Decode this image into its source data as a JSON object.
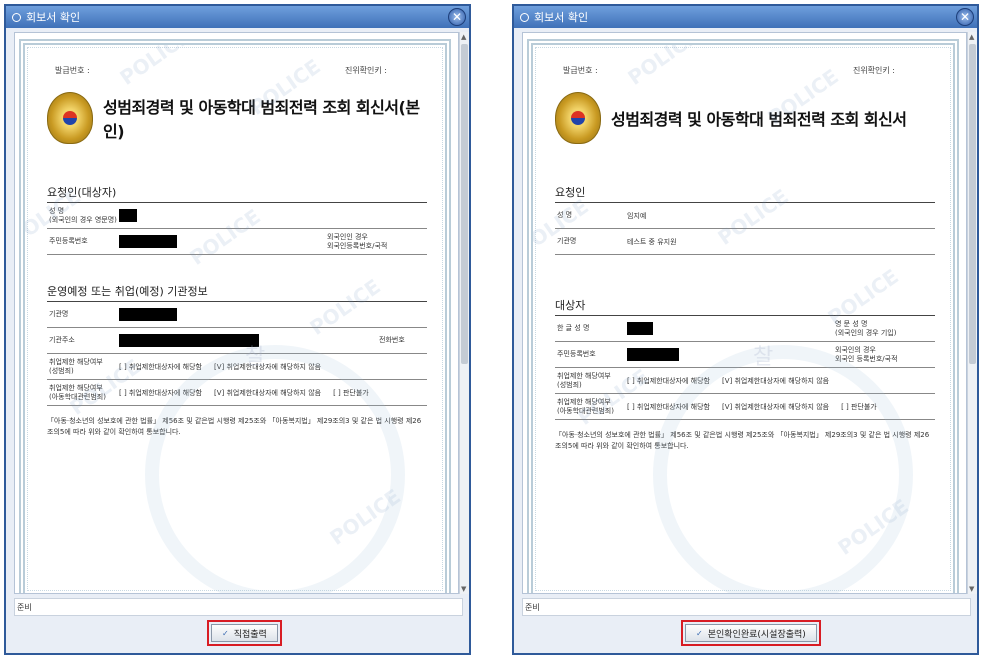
{
  "dialog_title": "회보서 확인",
  "status_label": "준비",
  "left": {
    "issue_no_label": "발급번호 :",
    "verify_key_label": "진위확인키 :",
    "doc_title": "성범죄경력 및 아동학대 범죄전력 조회 회신서(본인)",
    "requester_heading": "요청인(대상자)",
    "name_label": "성 명\n(외국인의 경우 영문명)",
    "rrn_label": "주민등록번호",
    "foreigner_label": "외국인인 경우\n외국인등록번호/국적",
    "institution_heading": "운영예정 또는 취업(예정) 기관정보",
    "inst_name_label": "기관명",
    "inst_addr_label": "기관주소",
    "phone_label": "전화번호",
    "sex_crime_label": "취업제한 해당여부\n(성범죄)",
    "child_abuse_label": "취업제한 해당여부\n(아동학대관련범죄)",
    "opt_applicable": "[ ] 취업제한대상자에 해당함",
    "opt_not_applicable": "[V] 취업제한대상자에 해당하지 않음",
    "opt_undeterminable": "[ ] 판단불가",
    "legal_text": "「아동·청소년의 성보호에 관한 법률」 제56조 및 같은법 시행령 제25조와 「아동복지법」 제29조의3 및 같은 법 시행령 제26조의5에 따라 위와 같이 확인하여 통보합니다.",
    "button_label": "직접출력"
  },
  "right": {
    "issue_no_label": "발급번호 :",
    "verify_key_label": "진위확인키 :",
    "doc_title": "성범죄경력 및 아동학대 범죄전력 조회 회신서",
    "requester_heading": "요청인",
    "name_label": "성 명",
    "name_value": "임지예",
    "inst_name_label": "기관명",
    "inst_name_value": "테스트 중 유지원",
    "subject_heading": "대상자",
    "korean_name_label": "한 글 성 명",
    "english_name_label": "영 문 성 명\n(외국인의 경우 기입)",
    "rrn_label": "주민등록번호",
    "foreigner_label": "외국인의 경우\n외국인 등록번호/국적",
    "sex_crime_label": "취업제한 해당여부\n(성범죄)",
    "child_abuse_label": "취업제한 해당여부\n(아동학대관련범죄)",
    "opt_applicable": "[ ] 취업제한대상자에 해당함",
    "opt_not_applicable": "[V] 취업제한대상자에 해당하지 않음",
    "opt_undeterminable": "[ ] 판단불가",
    "legal_text": "「아동·청소년의 성보호에 관한 법률」 제56조 및 같은법 시행령 제25조와 「아동복지법」 제29조의3 및 같은 법 시행령 제26조의5에 따라 위와 같이 확인하여 통보합니다.",
    "button_label": "본인확인완료(시설장출력)"
  },
  "colors": {
    "title_bar": "#3f71b8",
    "highlight": "#d81c24"
  },
  "icons": [
    "circle-icon",
    "close-icon",
    "police-emblem-icon",
    "check-icon"
  ]
}
